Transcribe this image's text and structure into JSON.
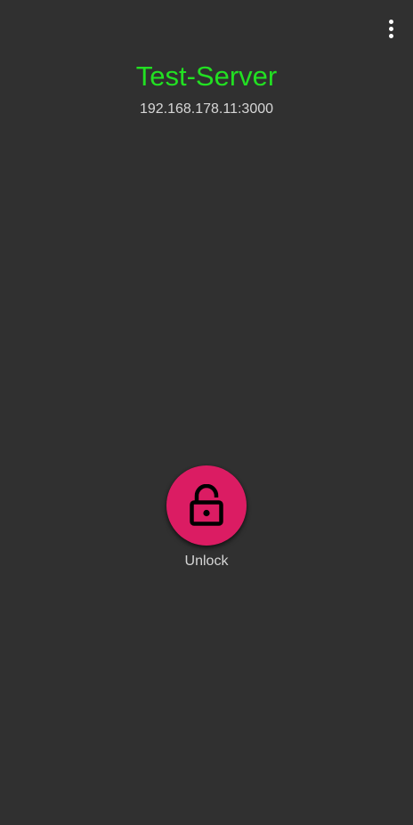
{
  "header": {
    "menu_icon": "more-vert-icon"
  },
  "server": {
    "name": "Test-Server",
    "address": "192.168.178.11:3000"
  },
  "action": {
    "icon": "lock-open-icon",
    "label": "Unlock"
  },
  "colors": {
    "background": "#303030",
    "title": "#22e022",
    "subtitle": "#d6d6d6",
    "accent": "#db1c63"
  }
}
